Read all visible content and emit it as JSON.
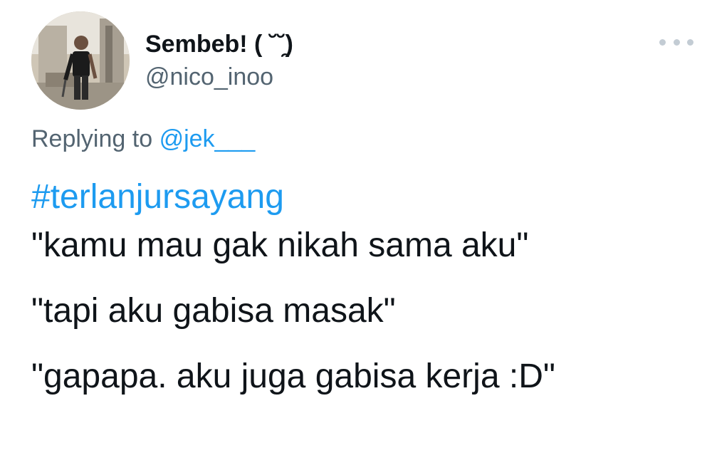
{
  "author": {
    "display_name": "Sembeb! ( ˘˘̯)",
    "handle": "@nico_inoo",
    "avatar_icon": "profile-photo"
  },
  "more_icon": "ellipsis-icon",
  "reply": {
    "prefix": "Replying to",
    "mention": "@jek___"
  },
  "tweet": {
    "hashtag": "#terlanjursayang",
    "lines": [
      "\"kamu mau gak nikah sama aku\"",
      "\"tapi aku gabisa masak\"",
      "\"gapapa. aku juga gabisa kerja :D\""
    ]
  },
  "colors": {
    "link": "#1d9bf0",
    "secondary_text": "#536471",
    "primary_text": "#0f1419",
    "background": "#ffffff"
  }
}
